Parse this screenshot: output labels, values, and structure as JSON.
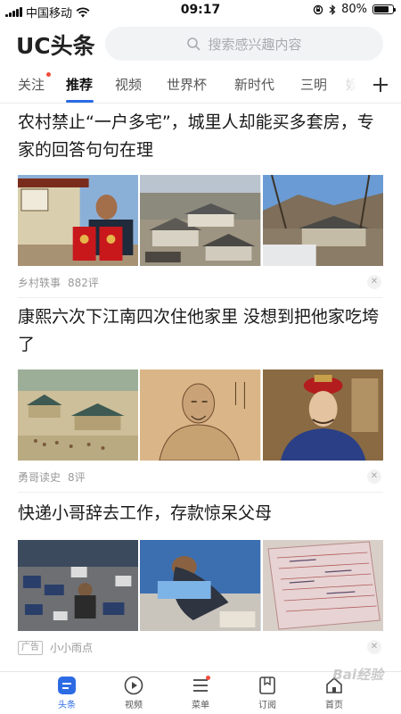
{
  "status_bar": {
    "carrier": "中国移动",
    "time": "09:17",
    "battery": "80%",
    "battery_level": 0.8,
    "icons": [
      "signal-icon",
      "wifi-icon",
      "rotation-lock-icon",
      "bluetooth-icon",
      "battery-icon"
    ]
  },
  "header": {
    "logo": "UC头条",
    "search_placeholder": "搜索感兴趣内容"
  },
  "tabs": {
    "items": [
      "关注",
      "推荐",
      "视频",
      "世界杯",
      "新时代",
      "三明",
      "娱"
    ],
    "active": "推荐",
    "add_icon": "plus-icon"
  },
  "articles": [
    {
      "title": "农村禁止“一户多宅”，城里人却能买多套房，专家的回答句句在理",
      "source": "乡村轶事",
      "comments": "882评",
      "images": [
        "man-holding-certificates",
        "village-houses",
        "mountain-village"
      ]
    },
    {
      "title": "康熙六次下江南四次住他家里 没想到把他家吃垮了",
      "source": "勇哥读史",
      "comments": "8评",
      "images": [
        "qing-painting-scene",
        "portrait-painting",
        "qing-official-costume"
      ]
    },
    {
      "title": "快递小哥辞去工作，存款惊呆父母",
      "ad_label": "广告",
      "source": "小小雨点",
      "images": [
        "courier-parcels",
        "sleeping-courier",
        "bank-passbook"
      ]
    }
  ],
  "bottom_nav": {
    "items": [
      {
        "label": "头条",
        "icon": "headline-icon",
        "active": true
      },
      {
        "label": "视频",
        "icon": "play-icon",
        "active": false
      },
      {
        "label": "菜单",
        "icon": "menu-icon",
        "active": false
      },
      {
        "label": "订阅",
        "icon": "subscribe-icon",
        "active": false
      },
      {
        "label": "首页",
        "icon": "home-icon",
        "active": false
      }
    ]
  },
  "watermark": "Bai经验",
  "colors": {
    "accent": "#2d6be4",
    "badge": "#f24c3d"
  }
}
